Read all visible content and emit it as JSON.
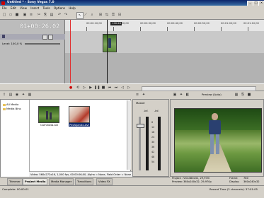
{
  "window": {
    "title": "Untitled * - Sony Vegas 7.0"
  },
  "menu": [
    "File",
    "Edit",
    "View",
    "Insert",
    "Tools",
    "Options",
    "Help"
  ],
  "toolbar": {
    "icons": [
      "new-icon",
      "open-icon",
      "save-icon",
      "render-icon",
      "properties-icon",
      "cut-icon",
      "copy-icon",
      "paste-icon",
      "undo-icon",
      "redo-icon",
      "edit-tool-icon",
      "envelope-tool-icon",
      "zoom-tool-icon",
      "snap-icon",
      "autoripple-icon",
      "lock-icon",
      "ignore-grouping-icon"
    ]
  },
  "timeline": {
    "timecode": "01+00:26.02",
    "level_label": "Level: 100,0 %",
    "ruler_labels": [
      "00:00:10;00",
      "00:00:20;00",
      "00:00:30;00",
      "00:00:40;00",
      "00:00:50;00",
      "00:01:00;00",
      "00:01:10;00"
    ],
    "cursor_label": "+00:26",
    "rate_label": "Rate: 0,00"
  },
  "explorer": {
    "tree": [
      "All Media",
      "Media Bins"
    ],
    "media": [
      {
        "label": "Caminata.avi",
        "selected": false
      },
      {
        "label": "Pesfojando.AVI",
        "selected": true
      }
    ],
    "status": "Video: 560x272x16, 1,000 fps, 00:00:06;00, Alpha = None, Field Order = None"
  },
  "mixer": {
    "title": "Master",
    "db_labels": [
      "-Inf.",
      "-Inf.",
      "6",
      "12",
      "18",
      "24",
      "30",
      "36",
      "42",
      "48",
      "54"
    ]
  },
  "preview": {
    "mode": "Preview (Auto)",
    "project": "Project:  720x480x32, 29,970i",
    "preview": "Preview:  360x240x32, 29,970p",
    "frame_label": "Frame:",
    "frame": "780",
    "display_label": "Display:",
    "display": "360x240x32"
  },
  "tabs": [
    "Trimmer",
    "Project Media",
    "Media Manager",
    "Transitions",
    "Video FX"
  ],
  "status": {
    "left": "Complete: 00:00:01",
    "right": "Record Time (2 channels): 37:01:05"
  },
  "colors": {
    "title_bar": "#0a246a",
    "playhead": "#e03030",
    "selection": "#0a246a"
  }
}
